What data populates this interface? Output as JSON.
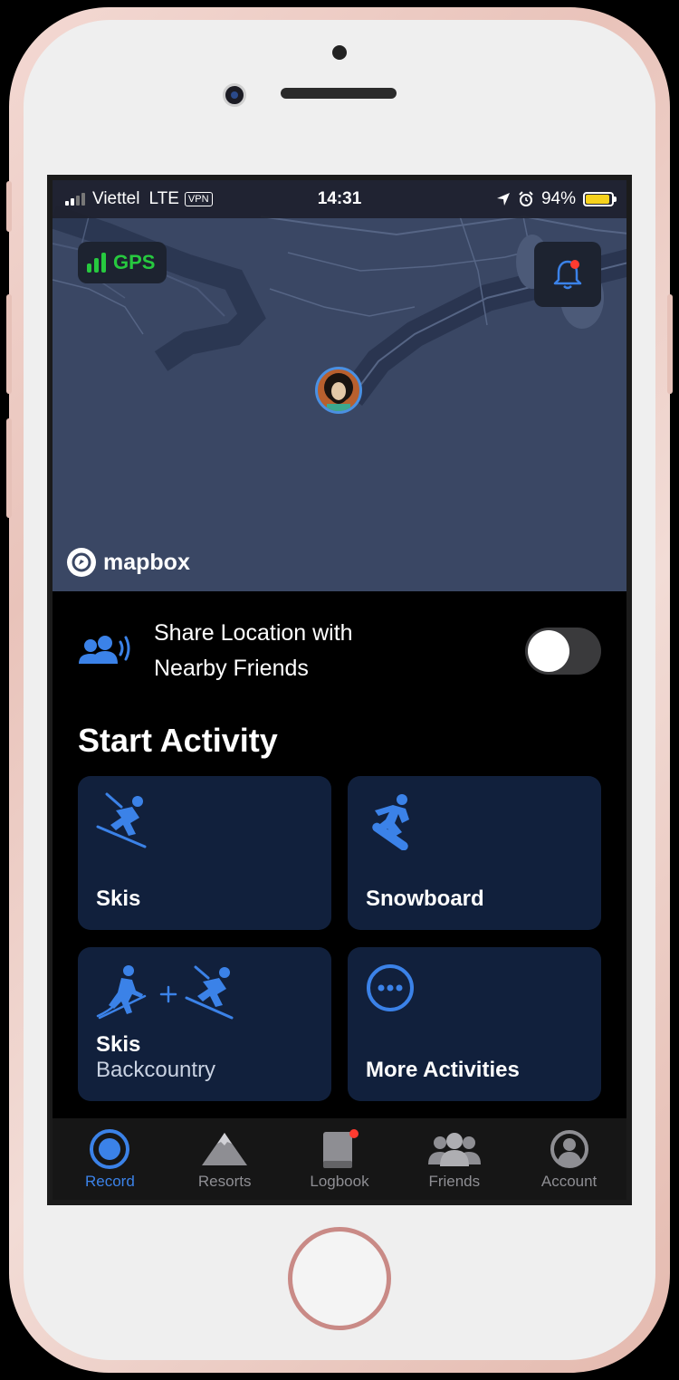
{
  "status_bar": {
    "carrier": "Viettel",
    "network": "LTE",
    "vpn": "VPN",
    "time": "14:31",
    "battery": "94%",
    "battery_level": 0.94
  },
  "map": {
    "gps_label": "GPS",
    "attribution": "mapbox"
  },
  "share_location": {
    "label": "Share Location with Nearby Friends",
    "enabled": false
  },
  "start_activity": {
    "title": "Start Activity",
    "cards": [
      {
        "label": "Skis",
        "sublabel": "",
        "icon": "skier-icon"
      },
      {
        "label": "Snowboard",
        "sublabel": "",
        "icon": "snowboarder-icon"
      },
      {
        "label": "Skis",
        "sublabel": "Backcountry",
        "icon": "backcountry-skis-icon"
      },
      {
        "label": "More Activities",
        "sublabel": "",
        "icon": "more-icon"
      }
    ]
  },
  "tabs": [
    {
      "label": "Record",
      "icon": "record-icon",
      "active": true
    },
    {
      "label": "Resorts",
      "icon": "mountain-icon",
      "active": false
    },
    {
      "label": "Logbook",
      "icon": "book-icon",
      "active": false
    },
    {
      "label": "Friends",
      "icon": "friends-icon",
      "active": false
    },
    {
      "label": "Account",
      "icon": "account-icon",
      "active": false
    }
  ],
  "colors": {
    "accent": "#3b82e8",
    "gps_green": "#27c93f",
    "card_bg": "#11203c",
    "map_bg": "#3a4764",
    "notification_dot": "#ff3b30",
    "battery": "#f7d21c"
  }
}
